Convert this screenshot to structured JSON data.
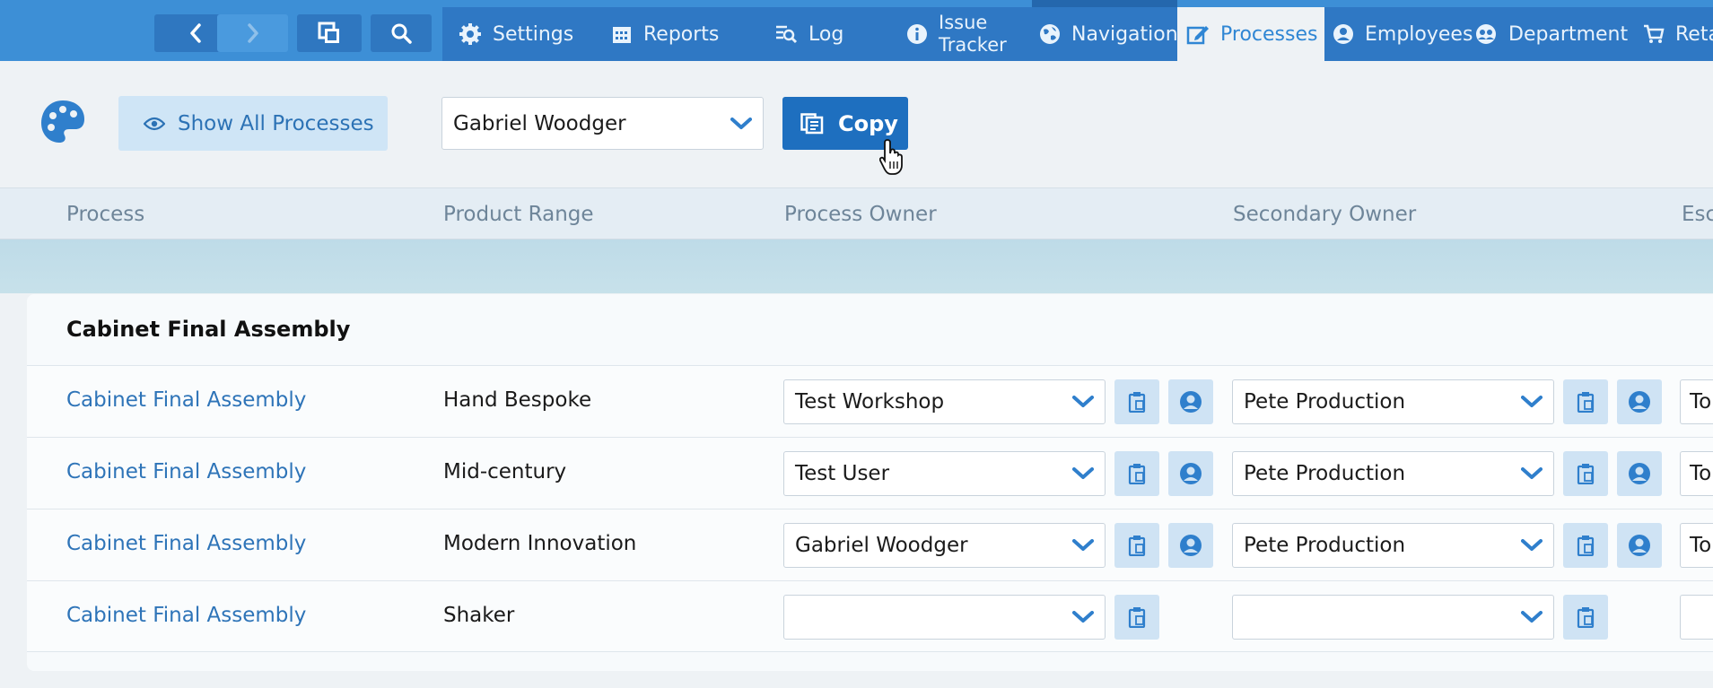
{
  "nav": {
    "tabs": [
      {
        "label": "Settings",
        "icon": "gear-icon"
      },
      {
        "label": "Reports",
        "icon": "calendar-icon"
      },
      {
        "label": "Log",
        "icon": "log-icon"
      },
      {
        "label_line1": "Issue",
        "label_line2": "Tracker",
        "icon": "info-icon"
      },
      {
        "label": "Navigation",
        "icon": "globe-icon"
      },
      {
        "label": "Processes",
        "icon": "edit-icon",
        "active": true
      },
      {
        "label": "Employees",
        "icon": "user-icon"
      },
      {
        "label": "Department",
        "icon": "group-icon"
      },
      {
        "label": "Reta",
        "icon": "cart-icon"
      }
    ]
  },
  "toolbar": {
    "show_all_label": "Show All Processes",
    "employee_select_value": "Gabriel Woodger",
    "copy_label": "Copy"
  },
  "columns": {
    "process": "Process",
    "product_range": "Product Range",
    "process_owner": "Process Owner",
    "secondary_owner": "Secondary Owner",
    "escalation": "Esc"
  },
  "group": {
    "title": "Cabinet Final Assembly",
    "rows": [
      {
        "process": "Cabinet Final Assembly",
        "range": "Hand Bespoke",
        "owner": "Test Workshop",
        "secondary": "Pete Production",
        "to": "To"
      },
      {
        "process": "Cabinet Final Assembly",
        "range": "Mid-century",
        "owner": "Test User",
        "secondary": "Pete Production",
        "to": "To"
      },
      {
        "process": "Cabinet Final Assembly",
        "range": "Modern Innovation",
        "owner": "Gabriel Woodger",
        "secondary": "Pete Production",
        "to": "To"
      },
      {
        "process": "Cabinet Final Assembly",
        "range": "Shaker",
        "owner": "",
        "secondary": "",
        "to": ""
      }
    ]
  },
  "colors": {
    "nav_bg": "#3d8fd6",
    "nav_tabs_bg": "#2f78c4",
    "accent": "#1e6fbf",
    "link": "#2e74b8"
  }
}
